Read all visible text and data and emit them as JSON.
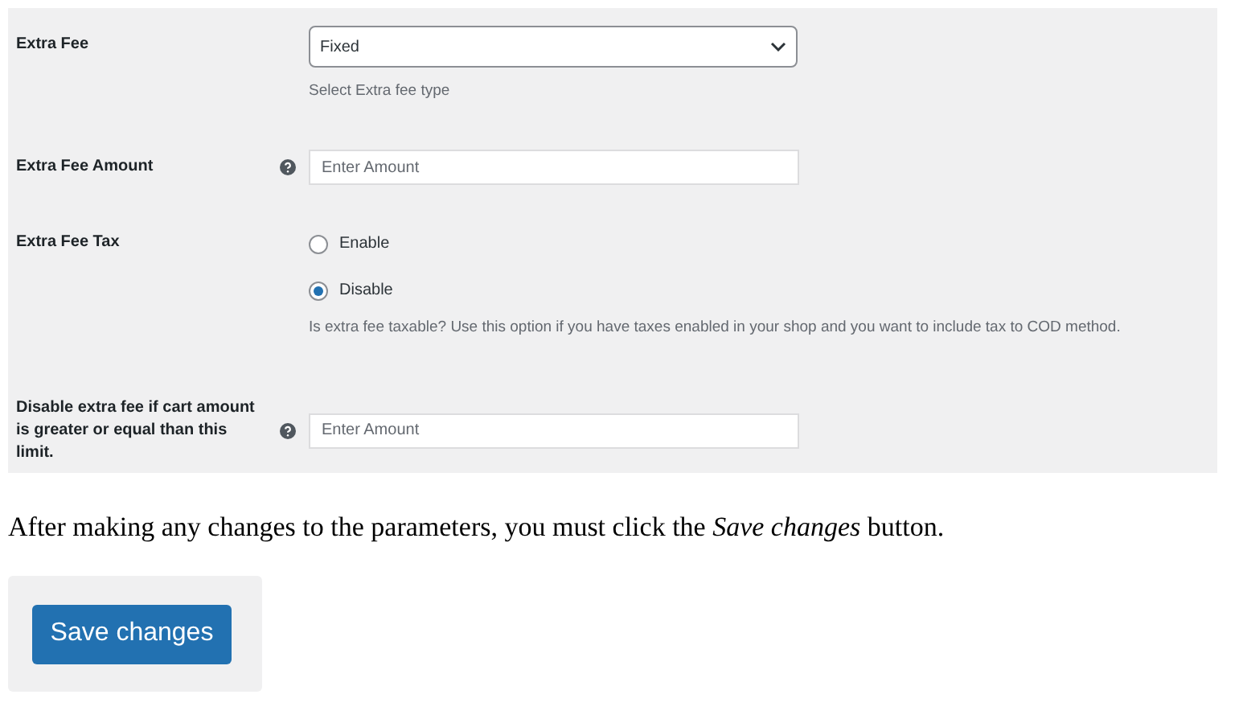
{
  "settings": [
    {
      "kind": "select",
      "label": "Extra Fee",
      "help": false,
      "value": "Fixed",
      "description": "Select Extra fee type"
    },
    {
      "kind": "text",
      "label": "Extra Fee Amount",
      "help": true,
      "placeholder": "Enter Amount"
    },
    {
      "kind": "radio",
      "label": "Extra Fee Tax",
      "help": false,
      "options": [
        {
          "label": "Enable",
          "selected": false
        },
        {
          "label": "Disable",
          "selected": true
        }
      ],
      "description": "Is extra fee taxable? Use this option if you have taxes enabled in your shop and you want to include tax to COD method."
    },
    {
      "kind": "text",
      "label": "Disable extra fee if cart amount is greater or equal than this limit.",
      "help": true,
      "placeholder": "Enter Amount"
    }
  ],
  "instruction": "After making any changes to the parameters, you must click the *Save changes* button.",
  "save_button": "Save changes"
}
